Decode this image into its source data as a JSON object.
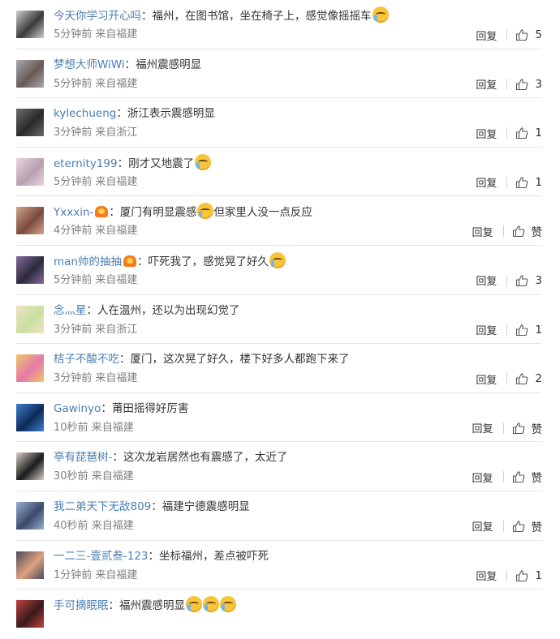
{
  "comments": [
    {
      "user": "今天你学习开心吗",
      "text": "福州，在图书馆，坐在椅子上，感觉像摇摇车",
      "emojis": 1,
      "badge": false,
      "time": "5分钟前",
      "source": "来自福建",
      "reply": "回复",
      "likes": "5",
      "avatar_colors": [
        "#3a3a3a",
        "#cfcfcf"
      ]
    },
    {
      "user": "梦想大师WiWi",
      "text": "福州震感明显",
      "emojis": 0,
      "badge": false,
      "time": "5分钟前",
      "source": "来自福建",
      "reply": "回复",
      "likes": "3",
      "avatar_colors": [
        "#6a5a55",
        "#a9a9b2"
      ]
    },
    {
      "user": "kylechueng",
      "text": "浙江表示震感明显",
      "emojis": 0,
      "badge": false,
      "time": "3分钟前",
      "source": "来自浙江",
      "reply": "回复",
      "likes": "1",
      "avatar_colors": [
        "#2a2a2a",
        "#6b6b6b"
      ]
    },
    {
      "user": "eternity199",
      "text": "刚才又地震了",
      "emojis": 1,
      "badge": false,
      "time": "5分钟前",
      "source": "来自福建",
      "reply": "回复",
      "likes": "1",
      "avatar_colors": [
        "#b89fb0",
        "#e9d6e0"
      ]
    },
    {
      "user": "Yxxxin-",
      "text": "厦门有明显震感",
      "text2": "但家里人没一点反应",
      "emojis": 1,
      "badge": true,
      "time": "4分钟前",
      "source": "来自福建",
      "reply": "回复",
      "likes": "赞",
      "avatar_colors": [
        "#7a4a40",
        "#d4a58a"
      ]
    },
    {
      "user": "man帅的抽抽",
      "text": "吓死我了，感觉晃了好久",
      "emojis": 1,
      "badge": true,
      "time": "5分钟前",
      "source": "来自福建",
      "reply": "回复",
      "likes": "3",
      "avatar_colors": [
        "#2a2a3a",
        "#8a6aa0"
      ]
    },
    {
      "user": "念灬星",
      "text": "人在温州，还以为出现幻觉了",
      "emojis": 0,
      "badge": false,
      "time": "3分钟前",
      "source": "来自浙江",
      "reply": "回复",
      "likes": "1",
      "avatar_colors": [
        "#c9e0a0",
        "#f0e2c0"
      ]
    },
    {
      "user": "桔子不酸不吃",
      "text": "厦门，这次晃了好久，楼下好多人都跑下来了",
      "emojis": 0,
      "badge": false,
      "time": "3分钟前",
      "source": "来自福建",
      "reply": "回复",
      "likes": "2",
      "avatar_colors": [
        "#e27aa8",
        "#f4c66a"
      ]
    },
    {
      "user": "Gawinyo",
      "text": "莆田摇得好厉害",
      "emojis": 0,
      "badge": false,
      "time": "10秒前",
      "source": "来自福建",
      "reply": "回复",
      "likes": "赞",
      "avatar_colors": [
        "#0d2a55",
        "#3f7fd0"
      ]
    },
    {
      "user": "亭有琵琶树-",
      "text": "这次龙岩居然也有震感了，太近了",
      "emojis": 0,
      "badge": false,
      "time": "30秒前",
      "source": "来自福建",
      "reply": "回复",
      "likes": "赞",
      "avatar_colors": [
        "#1a1a1a",
        "#d9cfc6"
      ]
    },
    {
      "user": "我二弟天下无敌809",
      "text": "福建宁德震感明显",
      "emojis": 0,
      "badge": false,
      "time": "40秒前",
      "source": "来自福建",
      "reply": "回复",
      "likes": "赞",
      "avatar_colors": [
        "#3a4a6a",
        "#9ab0d0"
      ]
    },
    {
      "user": "一二三-壹贰叁-123",
      "text": "坐标福州，差点被吓死",
      "emojis": 0,
      "badge": false,
      "time": "1分钟前",
      "source": "来自福建",
      "reply": "回复",
      "likes": "1",
      "avatar_colors": [
        "#e0a080",
        "#4a4a5a"
      ]
    },
    {
      "user": "手可摘眠眠",
      "text": "福州震感明显",
      "emojis": 3,
      "badge": false,
      "time": "",
      "source": "",
      "reply": "",
      "likes": "",
      "avatar_colors": [
        "#3a1a1a",
        "#c04040"
      ]
    }
  ],
  "icons": {
    "like": "thumbs-up-icon",
    "badge": "member-badge-icon",
    "emoji": "crying-emoji-icon"
  },
  "colors": {
    "username": "#4a7fb5",
    "meta": "#808080",
    "divider": "#e6e6e6"
  }
}
